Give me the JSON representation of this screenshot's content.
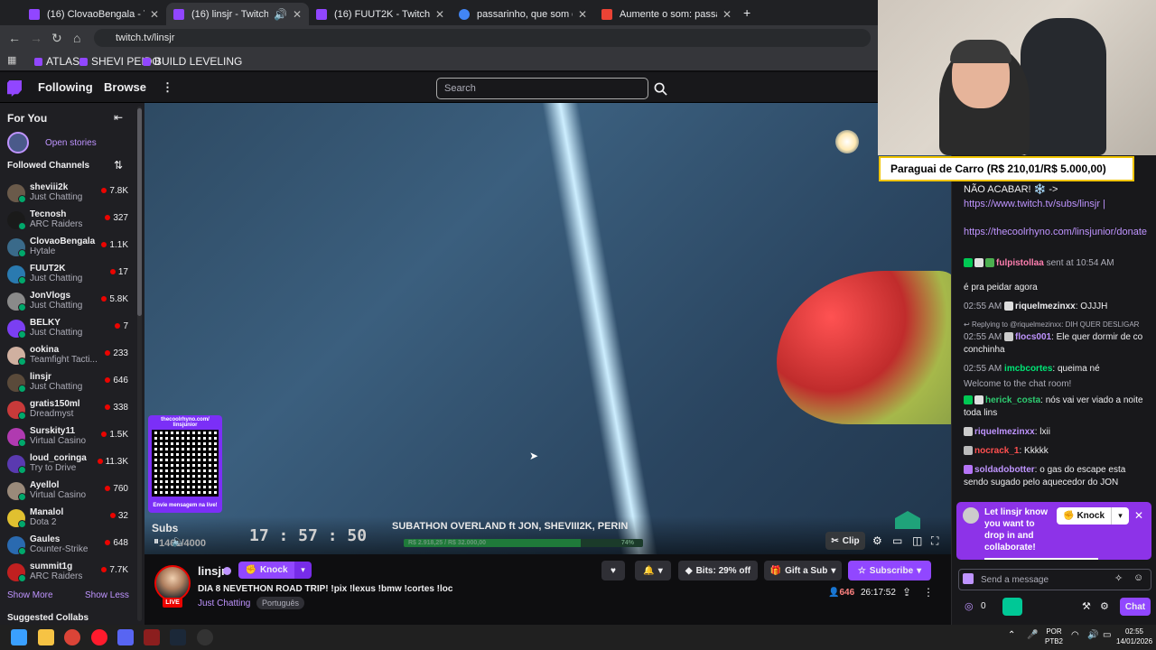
{
  "browser": {
    "tabs": [
      {
        "title": "(16) ClovaoBengala - Twitch",
        "color": "#9146ff"
      },
      {
        "title": "(16) linsjr - Twitch",
        "color": "#9146ff"
      },
      {
        "title": "(16) FUUT2K - Twitch",
        "color": "#9146ff"
      },
      {
        "title": "passarinho, que som é esse - G",
        "color": "#4285f4"
      },
      {
        "title": "Aumente o som: passarinho qu",
        "color": "#ea4335"
      }
    ],
    "url": "twitch.tv/linsjr",
    "bookmarks": [
      "ATLAS",
      "SHEVI PEIDO",
      "BUILD LEVELING"
    ]
  },
  "topnav": {
    "following": "Following",
    "browse": "Browse",
    "search_placeholder": "Search"
  },
  "sidebar": {
    "for_you": "For You",
    "open_stories": "Open stories",
    "followed_channels": "Followed Channels",
    "channels": [
      {
        "name": "sheviii2k",
        "game": "Just Chatting",
        "viewers": "7.8K",
        "color": "#6a5a4a"
      },
      {
        "name": "Tecnosh",
        "game": "ARC Raiders",
        "viewers": "327",
        "color": "#1a1a1a"
      },
      {
        "name": "ClovaoBengala",
        "game": "Hytale",
        "viewers": "1.1K",
        "color": "#3a6a8a"
      },
      {
        "name": "FUUT2K",
        "game": "Just Chatting",
        "viewers": "17",
        "color": "#2a7ab0"
      },
      {
        "name": "JonVlogs",
        "game": "Just Chatting",
        "viewers": "5.8K",
        "color": "#8a8a8a"
      },
      {
        "name": "BELKY",
        "game": "Just Chatting",
        "viewers": "7",
        "color": "#7b3ff2"
      },
      {
        "name": "ookina",
        "game": "Teamfight Tacti...",
        "viewers": "233",
        "color": "#d0b0a0"
      },
      {
        "name": "linsjr",
        "game": "Just Chatting",
        "viewers": "646",
        "color": "#5a4a3a"
      },
      {
        "name": "gratis150ml",
        "game": "Dreadmyst",
        "viewers": "338",
        "color": "#c83a3a"
      },
      {
        "name": "Surskity11",
        "game": "Virtual Casino",
        "viewers": "1.5K",
        "color": "#b03ab0"
      },
      {
        "name": "loud_coringa",
        "game": "Try to Drive",
        "viewers": "11.3K",
        "color": "#5a3ab0"
      },
      {
        "name": "Ayellol",
        "game": "Virtual Casino",
        "viewers": "760",
        "color": "#9a8a7a"
      },
      {
        "name": "Manalol",
        "game": "Dota 2",
        "viewers": "32",
        "color": "#e0c030"
      },
      {
        "name": "Gaules",
        "game": "Counter-Strike",
        "viewers": "648",
        "color": "#2a6ab0"
      },
      {
        "name": "summit1g",
        "game": "ARC Raiders",
        "viewers": "7.7K",
        "color": "#c02020"
      }
    ],
    "show_more": "Show More",
    "show_less": "Show Less",
    "suggested": "Suggested Collabs"
  },
  "video": {
    "qr_top": "thecoolrhyno.com/ linsjunior",
    "qr_bottom": "Envie mensagem na live!",
    "subs_label": "Subs",
    "subs_count": "1461/4000",
    "timer": "17 : 57 : 50",
    "subathon": "SUBATHON OVERLAND ft JON, SHEVIII2K, PERIN",
    "progress_left": "R$ 2.918,25 / R$ 32.000,00",
    "progress_right": "74%",
    "progress_fraction": 0.74,
    "clip": "Clip"
  },
  "stream": {
    "channel": "linsjr",
    "knock": "Knock",
    "title": "DIA 8 NEVETHON ROAD TRIP! !pix !lexus !bmw !cortes !loc",
    "category": "Just Chatting",
    "tag": "Português",
    "live": "LIVE",
    "bits": "Bits: 29% off",
    "gift": "Gift a Sub",
    "subscribe": "Subscribe",
    "viewers": "646",
    "uptime": "26:17:52"
  },
  "chat": {
    "messages": [
      {
        "text": "NÃO ACABAR! ❄️ ->"
      },
      {
        "link": "https://www.twitch.tv/subs/linsjr |"
      },
      {
        "link": "https://thecoolrhyno.com/linsjunior/donate"
      },
      {
        "user": "fulpistollaa",
        "text": "sent at 10:54 AM"
      },
      {
        "text": "é pra peidar agora"
      },
      {
        "ts": "02:55 AM",
        "user": "riquelmezinxx",
        "text": ": OJJJH"
      },
      {
        "reply": "Replying to @riquelmezinxx: DIH QUER DESLIGAR"
      },
      {
        "ts": "02:55 AM",
        "user": "flocs001",
        "text": ": Ele quer dormir de co conchinha"
      },
      {
        "ts": "02:55 AM",
        "user": "imcbcortes",
        "text": ": queima né"
      },
      {
        "text": "Welcome to the chat room!"
      },
      {
        "user": "herick_costa",
        "text": ": nós vai ver viado a noite toda lins"
      },
      {
        "user": "riquelmezinxx",
        "text": ": lxii"
      },
      {
        "user": "nocrack_1",
        "text": ": Kkkkk"
      },
      {
        "user": "soldadobotter",
        "text": ": o gas do escape esta sendo sugado pelo aquecedor do JON"
      }
    ],
    "knock_card": "Let linsjr know you want to drop in and collaborate!",
    "knock": "Knock",
    "input_placeholder": "Send a message",
    "points": "0",
    "chat_btn": "Chat"
  },
  "webcam": {
    "goal": "Paraguai de Carro (R$ 210,01/R$ 5.000,00)"
  },
  "taskbar": {
    "lang1": "POR",
    "lang2": "PTB2",
    "time": "02:55",
    "date": "14/01/2026"
  }
}
